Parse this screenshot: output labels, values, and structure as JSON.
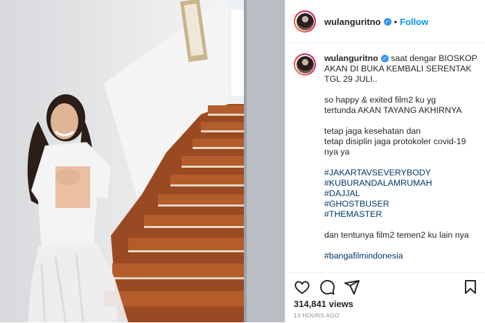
{
  "post": {
    "username": "wulanguritno",
    "follow_label": "Follow",
    "separator": "•",
    "verified_glyph": "✓",
    "caption_lines": [
      "saat dengar BIOSKOP",
      "AKAN DI BUKA KEMBALI SERENTAK",
      "TGL 29 JULI..",
      "",
      "so happy & exited film2 ku yg",
      "tertunda AKAN TAYANG AKHIRNYA",
      "",
      "tetap jaga kesehatan dan",
      "tetap disiplin jaga protokoler covid-19",
      "nya ya",
      ""
    ],
    "hashtags": [
      "#JAKARTAVSEVERYBODY",
      "#KUBURANDALAMRUMAH",
      "#DAJJAL",
      "#GHOSTBUSER",
      "#THEMASTER"
    ],
    "closing_line": "dan tentunya film2 temen2 ku lain nya",
    "cut_hashtag": "#bangafilmindonesia",
    "views": "314,841 views",
    "timestamp": "13 HOURS AGO"
  },
  "icons": [
    "heart-icon",
    "comment-icon",
    "share-icon",
    "bookmark-icon",
    "verified-badge-icon"
  ],
  "colors": {
    "link": "#00376b",
    "follow": "#0095f6",
    "verified": "#3897f0",
    "muted": "#8e8e8e"
  }
}
